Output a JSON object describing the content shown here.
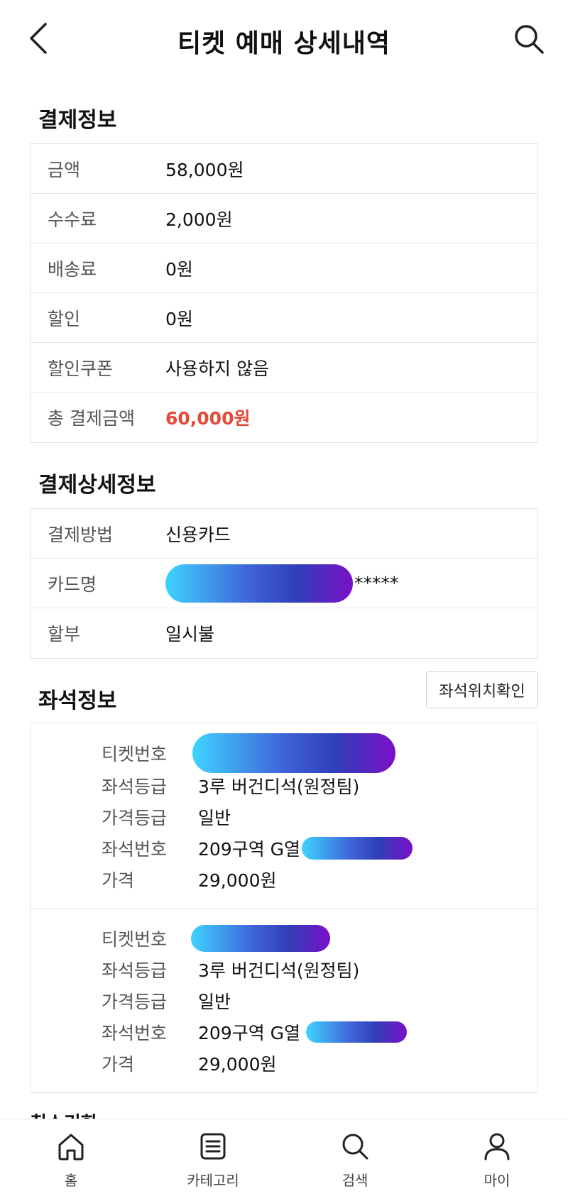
{
  "header": {
    "title": "티켓 예매 상세내역"
  },
  "payment": {
    "title": "결제정보",
    "rows": [
      {
        "label": "금액",
        "value": "58,000원"
      },
      {
        "label": "수수료",
        "value": "2,000원"
      },
      {
        "label": "배송료",
        "value": "0원"
      },
      {
        "label": "할인",
        "value": "0원"
      },
      {
        "label": "할인쿠폰",
        "value": "사용하지 않음"
      },
      {
        "label": "총 결제금액",
        "value": "60,000원"
      }
    ]
  },
  "payment_detail": {
    "title": "결제상세정보",
    "method_label": "결제방법",
    "method_value": "신용카드",
    "card_label": "카드명",
    "card_suffix": "*****",
    "installment_label": "할부",
    "installment_value": "일시불"
  },
  "seat": {
    "title": "좌석정보",
    "locate_button": "좌석위치확인",
    "tickets": [
      {
        "ticket_label": "티켓번호",
        "grade_label": "좌석등급",
        "grade": "3루 버건디석(원정팀)",
        "price_grade_label": "가격등급",
        "price_grade": "일반",
        "seat_label": "좌석번호",
        "seat": "209구역 G열",
        "price_label": "가격",
        "price": "29,000원"
      },
      {
        "ticket_label": "티켓번호",
        "grade_label": "좌석등급",
        "grade": "3루 버건디석(원정팀)",
        "price_grade_label": "가격등급",
        "price_grade": "일반",
        "seat_label": "좌석번호",
        "seat": "209구역 G열",
        "price_label": "가격",
        "price": "29,000원"
      }
    ]
  },
  "cancel": {
    "title": "취소기한"
  },
  "nav": {
    "items": [
      {
        "label": "홈",
        "icon": "home-icon"
      },
      {
        "label": "카테고리",
        "icon": "list-icon"
      },
      {
        "label": "검색",
        "icon": "search-icon"
      },
      {
        "label": "마이",
        "icon": "person-icon"
      }
    ]
  },
  "colors": {
    "total": "#e04b3a"
  }
}
